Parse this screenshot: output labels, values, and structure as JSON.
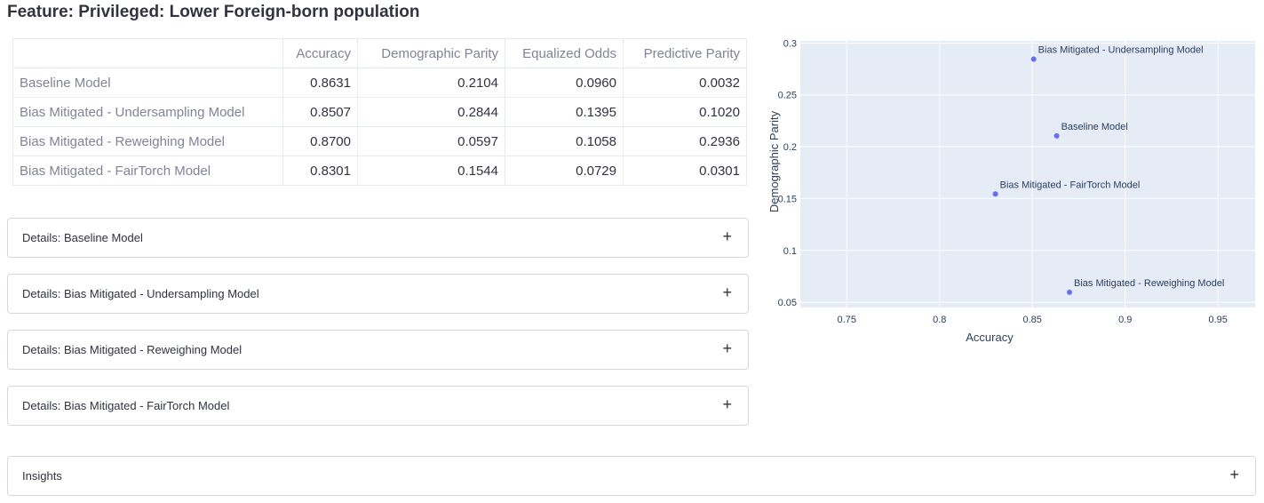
{
  "page_title": "Feature: Privileged: Lower Foreign-born population",
  "table": {
    "columns": [
      "",
      "Accuracy",
      "Demographic Parity",
      "Equalized Odds",
      "Predictive Parity"
    ],
    "rows": [
      {
        "model": "Baseline Model",
        "values": [
          "0.8631",
          "0.2104",
          "0.0960",
          "0.0032"
        ]
      },
      {
        "model": "Bias Mitigated - Undersampling Model",
        "values": [
          "0.8507",
          "0.2844",
          "0.1395",
          "0.1020"
        ]
      },
      {
        "model": "Bias Mitigated - Reweighing Model",
        "values": [
          "0.8700",
          "0.0597",
          "0.1058",
          "0.2936"
        ]
      },
      {
        "model": "Bias Mitigated - FairTorch Model",
        "values": [
          "0.8301",
          "0.1544",
          "0.0729",
          "0.0301"
        ]
      }
    ]
  },
  "expanders": [
    {
      "label": "Details: Baseline Model",
      "icon": "plus-icon"
    },
    {
      "label": "Details: Bias Mitigated - Undersampling Model",
      "icon": "plus-icon"
    },
    {
      "label": "Details: Bias Mitigated - Reweighing Model",
      "icon": "plus-icon"
    },
    {
      "label": "Details: Bias Mitigated - FairTorch Model",
      "icon": "plus-icon"
    }
  ],
  "insights": {
    "label": "Insights",
    "icon": "plus-icon"
  },
  "chart_data": {
    "type": "scatter",
    "xlabel": "Accuracy",
    "ylabel": "Demographic Parity",
    "xlim": [
      0.725,
      0.97
    ],
    "ylim": [
      0.045,
      0.302
    ],
    "xticks": [
      0.75,
      0.8,
      0.85,
      0.9,
      0.95
    ],
    "xtick_labels": [
      "0.75",
      "0.8",
      "0.85",
      "0.9",
      "0.95"
    ],
    "yticks": [
      0.05,
      0.1,
      0.15,
      0.2,
      0.25,
      0.3
    ],
    "ytick_labels": [
      "0.05",
      "0.1",
      "0.15",
      "0.2",
      "0.25",
      "0.3"
    ],
    "grid": true,
    "points": [
      {
        "label": "Baseline Model",
        "x": 0.8631,
        "y": 0.2104
      },
      {
        "label": "Bias Mitigated - Undersampling Model",
        "x": 0.8507,
        "y": 0.2844
      },
      {
        "label": "Bias Mitigated - Reweighing Model",
        "x": 0.87,
        "y": 0.0597
      },
      {
        "label": "Bias Mitigated - FairTorch Model",
        "x": 0.8301,
        "y": 0.1544
      }
    ],
    "colors": {
      "marker": "#636efa",
      "plot_bg": "#e5ecf6",
      "grid": "#ffffff"
    }
  }
}
